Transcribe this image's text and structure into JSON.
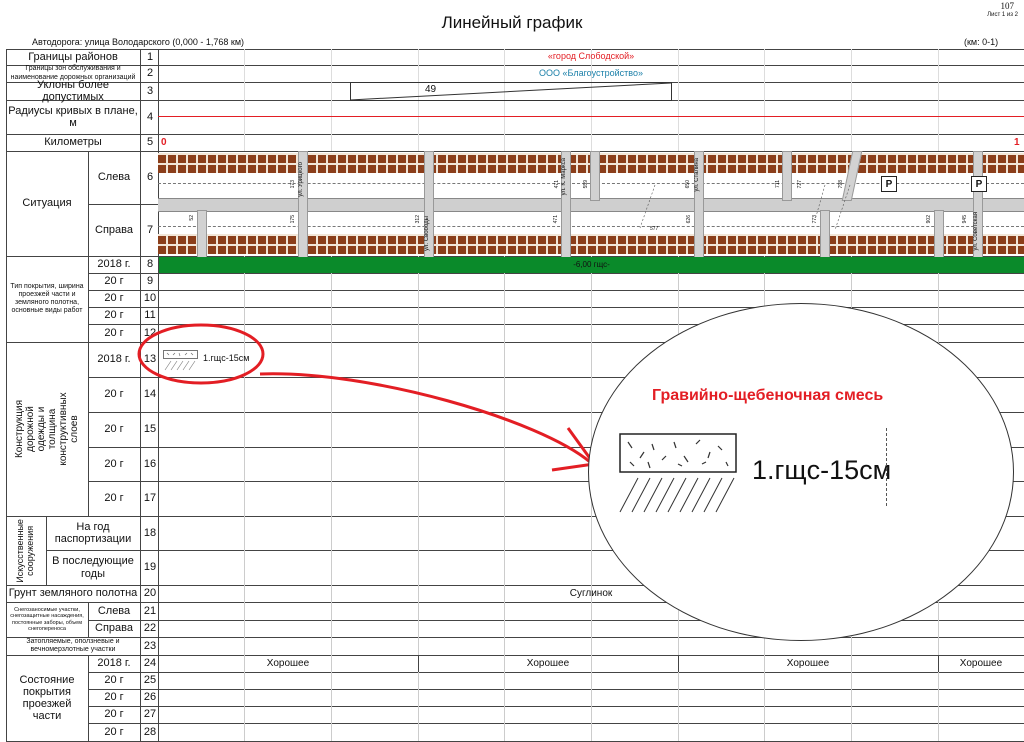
{
  "page": {
    "number": "107",
    "sheet": "Лист 1 из 2",
    "title": "Линейный график",
    "road": "Автодорога: улица Володарского (0,000 - 1,768 км)",
    "km_range": "(км: 0-1)"
  },
  "rows": {
    "r1": {
      "label": "Границы районов",
      "num": "1",
      "value": "«город Слободской»"
    },
    "r2": {
      "label": "Границы зон обслуживания и наименование дорожных организаций",
      "num": "2",
      "value": "ООО «Благоустройство»"
    },
    "r3": {
      "label": "Уклоны более допустимых",
      "num": "3",
      "value": "49"
    },
    "r4": {
      "label": "Радиусы кривых в плане, м",
      "num": "4"
    },
    "r5": {
      "label": "Километры",
      "num": "5",
      "km_start": "0",
      "km_end": "1"
    },
    "situation": {
      "label": "Ситуация",
      "left": "Слева",
      "right": "Справа",
      "num_left": "6",
      "num_right": "7"
    },
    "pavement": {
      "label": "Тип покрытия, ширина проезжей части и земляного полотна, основные виды работ",
      "years": [
        "2018 г.",
        "20   г",
        "20   г",
        "20   г",
        "20   г"
      ],
      "nums": [
        "8",
        "9",
        "10",
        "11",
        "12"
      ],
      "value_2018": "-6,00 гщс-"
    },
    "construction": {
      "label": "Конструкция дорожной одежды и толщина конструктивных слоев",
      "years": [
        "2018 г.",
        "20   г",
        "20   г",
        "20   г",
        "20   г"
      ],
      "nums": [
        "13",
        "14",
        "15",
        "16",
        "17"
      ],
      "layer": "1.гщс-15см"
    },
    "structures": {
      "label": "Искусственные сооружения",
      "sub1": "На год паспортизации",
      "sub2": "В последующие годы",
      "nums": [
        "18",
        "19"
      ]
    },
    "r20": {
      "label": "Грунт земляного полотна",
      "num": "20",
      "value": "Суглинок"
    },
    "snow": {
      "label": "Снегозаносимые участки, снегозащитные насаждения, постоянные заборы, объем снегопереноса",
      "left": "Слева",
      "right": "Справа",
      "nums": [
        "21",
        "22"
      ]
    },
    "r23": {
      "label": "Затопляемые, оползневые и вечномерзлотные участки",
      "num": "23"
    },
    "condition": {
      "label": "Состояние покрытия проезжей части",
      "years": [
        "2018 г.",
        "20   г",
        "20   г",
        "20   г",
        "20   г"
      ],
      "nums": [
        "24",
        "25",
        "26",
        "27",
        "28"
      ],
      "values": [
        "Хорошее",
        "Хорошее",
        "Хорошее",
        "Хорошее"
      ]
    }
  },
  "situation_marks": {
    "left_numbers": [
      "173",
      "471",
      "559",
      "650",
      "711",
      "727",
      "798"
    ],
    "right_numbers": [
      "52",
      "175",
      "312",
      "471",
      "577",
      "626",
      "773",
      "902",
      "945"
    ],
    "street_labels": [
      "ул. Урицкого",
      "ул. Свободы",
      "ул. К. Маркса",
      "ул. Сталина",
      "ул. Советская"
    ],
    "parking": "P"
  },
  "zoom": {
    "caption": "Гравийно-щебеночная смесь",
    "layer": "1.гщс-15см"
  },
  "colors": {
    "red": "#e31e24",
    "teal": "#1a7fa8",
    "green": "#0a8a2a",
    "brick": "#8b3e1a"
  }
}
